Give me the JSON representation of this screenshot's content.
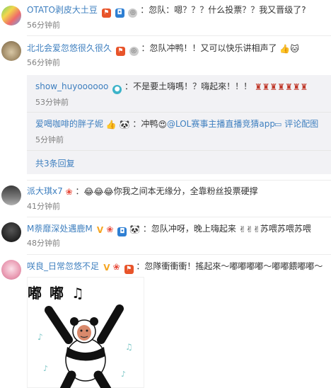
{
  "comments": [
    {
      "username": "OTATO剥皮大土豆",
      "text": "忽队：嗯？？？什么投票？？我又晋级了?",
      "time": "56分钟前"
    },
    {
      "username": "北北会爱忽悠很久很久",
      "text": "忽队冲鸭！！又可以快乐讲相声了",
      "time": "56分钟前"
    },
    {
      "username": "派大琪x7",
      "text": "你我之间本无缘分，全靠粉丝投票硬撑",
      "time": "41分钟前"
    },
    {
      "username": "M萘靡深处遇鹿M",
      "text": "忽队冲呀，晚上嗨起来",
      "text2": "苏喂苏喂苏喂",
      "time": "48分钟前"
    },
    {
      "username": "咲良_日常忽悠不足",
      "text": "忽隊衝衝衝！搖起來～嘟嘟嘟嘟～嘟嘟餵嘟嘟～"
    }
  ],
  "replies": [
    {
      "username": "show_huyoooooo",
      "text": "不是要土嗨嗎！？嗨起來！！！",
      "time": "53分钟前"
    },
    {
      "username": "爱喝咖啡的胖子妮",
      "text_prefix": "冲鸭",
      "mention": "@LOL赛事主播直播竞猜app",
      "time": "5分钟前",
      "action": "评论配图"
    }
  ],
  "more_replies": "共3条回复",
  "image": {
    "caption": "嘟 嘟 ♫"
  },
  "colors": {
    "orange_name": "#eb7350",
    "link_blue": "#3e7fbf",
    "reply_bg": "#f2f2f5"
  }
}
